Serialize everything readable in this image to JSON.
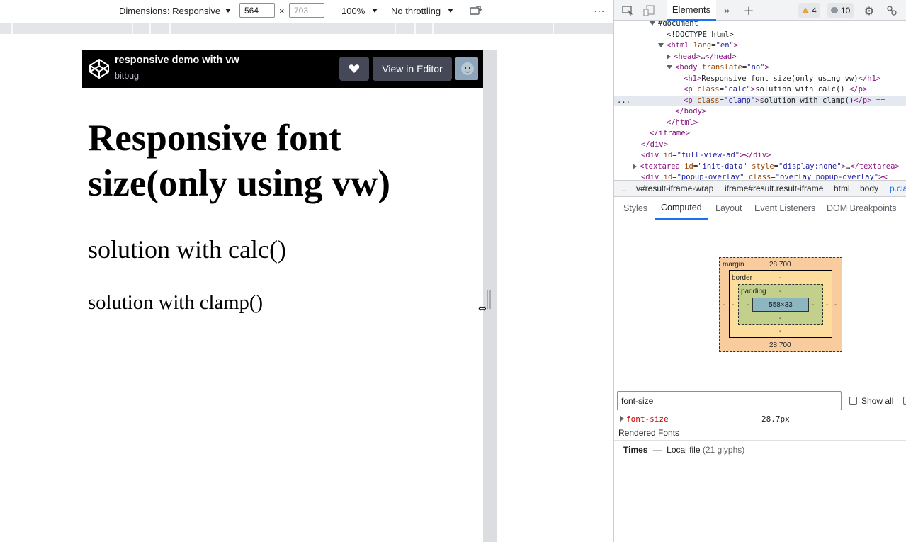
{
  "device_toolbar": {
    "dimensions_label": "Dimensions: Responsive",
    "width_value": "564",
    "times": "×",
    "height_placeholder": "703",
    "zoom": "100%",
    "throttling": "No throttling",
    "more_icon": "⋮"
  },
  "codepen": {
    "title": "responsive demo with vw",
    "author": "bitbug",
    "view_in_editor": "View in Editor"
  },
  "page": {
    "h1": "Responsive font size(only using vw)",
    "p_calc": "solution with calc()",
    "p_clamp": "solution with clamp()"
  },
  "devtools": {
    "elements_tab": "Elements",
    "warnings_count": "4",
    "messages_count": "10",
    "dom": [
      {
        "indent": 5,
        "arrow": "down",
        "html": "#document",
        "kind": "doc"
      },
      {
        "indent": 6,
        "arrow": "",
        "text": "<!DOCTYPE html>",
        "kind": "doctype"
      },
      {
        "indent": 6,
        "arrow": "down",
        "open": "html",
        "attrs": [
          [
            "lang",
            "en"
          ]
        ],
        "close": false
      },
      {
        "indent": 7,
        "arrow": "right",
        "open": "head",
        "collapsed": true
      },
      {
        "indent": 7,
        "arrow": "down",
        "open": "body",
        "attrs": [
          [
            "translate",
            "no"
          ]
        ],
        "close": false
      },
      {
        "indent": 8,
        "arrow": "",
        "open": "h1",
        "inner": "Responsive font size(only using vw)",
        "close": true
      },
      {
        "indent": 8,
        "arrow": "",
        "open": "p",
        "attrs": [
          [
            "class",
            "calc"
          ]
        ],
        "inner": "solution with calc() ",
        "close": true
      },
      {
        "indent": 8,
        "arrow": "",
        "open": "p",
        "attrs": [
          [
            "class",
            "clamp"
          ]
        ],
        "inner": "solution with clamp()",
        "close": true,
        "selected": true,
        "suffix": " == "
      },
      {
        "indent": 7,
        "arrow": "",
        "closing": "body"
      },
      {
        "indent": 6,
        "arrow": "",
        "closing": "html"
      },
      {
        "indent": 4,
        "arrow": "",
        "closing": "iframe"
      },
      {
        "indent": 3,
        "arrow": "",
        "closing": "div"
      },
      {
        "indent": 3,
        "arrow": "",
        "open": "div",
        "attrs": [
          [
            "id",
            "full-view-ad"
          ]
        ],
        "inner": "",
        "close": true,
        "closeTag": "div"
      },
      {
        "indent": 3,
        "arrow": "right",
        "open": "textarea",
        "attrs": [
          [
            "id",
            "init-data"
          ],
          [
            "style",
            "display:none"
          ]
        ],
        "collapsed": true
      },
      {
        "indent": 3,
        "arrow": "",
        "open": "div",
        "attrs": [
          [
            "id",
            "popup-overlay"
          ],
          [
            "class",
            "overlay popup-overlay"
          ]
        ],
        "partial": true
      }
    ],
    "more_indicator": "...",
    "breadcrumbs": [
      "v#result-iframe-wrap",
      "iframe#result.result-iframe",
      "html",
      "body",
      "p.cla"
    ],
    "subtabs": [
      "Styles",
      "Computed",
      "Layout",
      "Event Listeners",
      "DOM Breakpoints"
    ],
    "box_model": {
      "margin_label": "margin",
      "margin_top": "28.700",
      "margin_bottom": "28.700",
      "margin_side": "-",
      "border_label": "border",
      "border_value": "-",
      "padding_label": "padding",
      "padding_value": "-",
      "content": "558×33"
    },
    "filter_value": "font-size",
    "show_all": "Show all",
    "property_name": "font-size",
    "property_value": "28.7px",
    "rendered_fonts_heading": "Rendered Fonts",
    "font_family": "Times",
    "font_dash": "—",
    "font_source": "Local file",
    "font_glyphs": "(21 glyphs)"
  }
}
